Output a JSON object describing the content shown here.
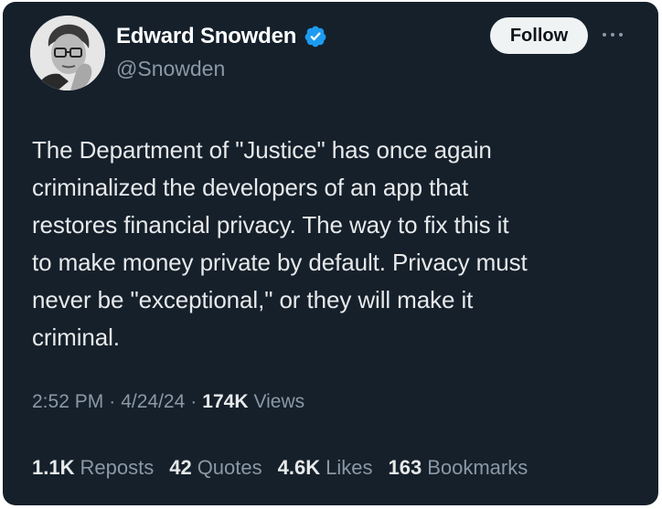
{
  "author": {
    "display_name": "Edward Snowden",
    "handle": "@Snowden",
    "verified": true,
    "verified_color": "#1d9bf0",
    "avatar": "profile-photo"
  },
  "actions": {
    "follow_label": "Follow",
    "more_icon": "more-horizontal-icon"
  },
  "tweet": {
    "text": "The Department of \"Justice\" has once again\ncriminalized the developers of an app that\nrestores financial privacy. The way to fix this it\nto make money private by default. Privacy must\nnever be \"exceptional,\" or they will make it\ncriminal."
  },
  "meta": {
    "time": "2:52 PM",
    "separator": "·",
    "date": "4/24/24",
    "views_count": "174K",
    "views_label": "Views"
  },
  "stats": [
    {
      "count": "1.1K",
      "label": "Reposts"
    },
    {
      "count": "42",
      "label": "Quotes"
    },
    {
      "count": "4.6K",
      "label": "Likes"
    },
    {
      "count": "163",
      "label": "Bookmarks"
    }
  ],
  "colors": {
    "background": "#15202b",
    "text_primary": "#e7e9ea",
    "text_secondary": "#8b98a5",
    "button_bg": "#eff3f4"
  }
}
